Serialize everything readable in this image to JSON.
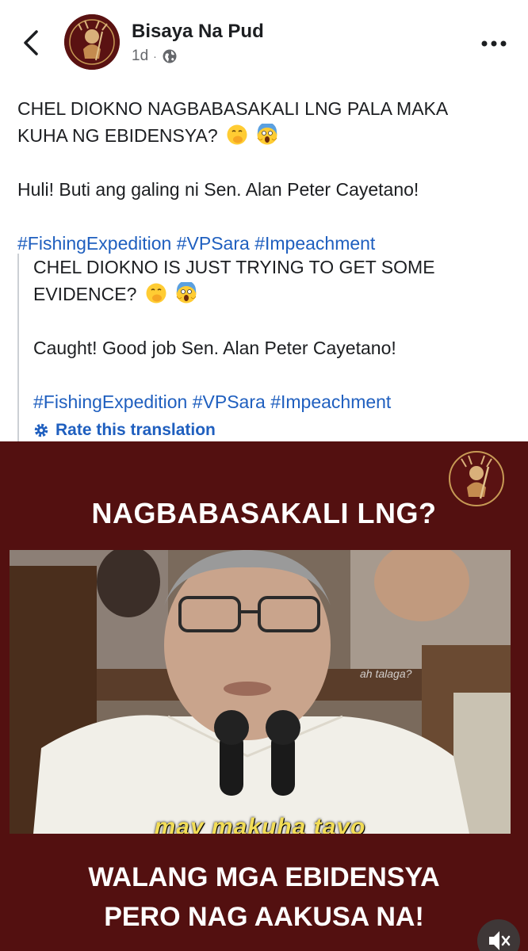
{
  "header": {
    "page_name": "Bisaya Na Pud",
    "time": "1d",
    "separator": "·"
  },
  "post": {
    "line1": "CHEL DIOKNO NAGBABASAKALI LNG PALA MAKA",
    "line2": "KUHA NG EBIDENSYA?",
    "line3": "Huli! Buti ang galing ni Sen. Alan Peter Cayetano!",
    "hashtags": [
      "#FishingExpedition",
      "#VPSara",
      "#Impeachment"
    ]
  },
  "translation": {
    "line1": "CHEL DIOKNO IS JUST TRYING TO GET SOME",
    "line2": "EVIDENCE?",
    "line3": "Caught! Good job Sen. Alan Peter Cayetano!",
    "hashtags": [
      "#FishingExpedition",
      "#VPSara",
      "#Impeachment"
    ],
    "rate_label": "Rate this translation"
  },
  "media": {
    "headline": "NAGBABASAKALI LNG?",
    "watermark": "ah talaga?",
    "subtitle": "may makuha tayo",
    "caption_line1": "WALANG MGA EBIDENSYA",
    "caption_line2": "PERO NAG AAKUSA NA!"
  },
  "colors": {
    "link": "#1f5fbf",
    "media_bg": "#531010",
    "subtitle": "#f2dd57"
  },
  "icons": {
    "back": "chevron-left-icon",
    "privacy": "globe-icon",
    "more": "more-horizontal-icon",
    "rate": "gear-icon",
    "mute": "speaker-muted-icon"
  }
}
